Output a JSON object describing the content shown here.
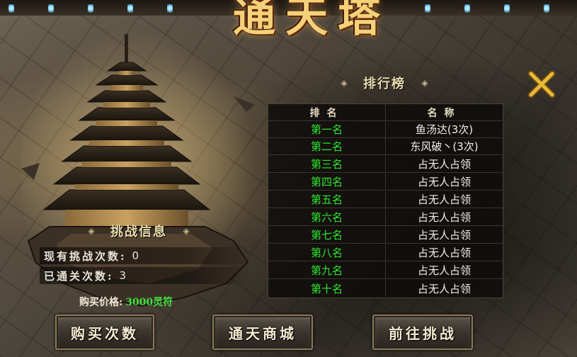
{
  "title": "通天塔",
  "ranking": {
    "header": "排行榜",
    "columns": [
      "排名",
      "名称"
    ],
    "rows": [
      {
        "rank": "第一名",
        "name": "鱼汤达(3次)"
      },
      {
        "rank": "第二名",
        "name": "东风破丶(3次)"
      },
      {
        "rank": "第三名",
        "name": "占无人占领"
      },
      {
        "rank": "第四名",
        "name": "占无人占领"
      },
      {
        "rank": "第五名",
        "name": "占无人占领"
      },
      {
        "rank": "第六名",
        "name": "占无人占领"
      },
      {
        "rank": "第七名",
        "name": "占无人占领"
      },
      {
        "rank": "第八名",
        "name": "占无人占领"
      },
      {
        "rank": "第九名",
        "name": "占无人占领"
      },
      {
        "rank": "第十名",
        "name": "占无人占领"
      }
    ]
  },
  "challenge_info": {
    "header": "挑战信息",
    "current_label": "现有挑战次数:",
    "current_value": "0",
    "passed_label": "已通关次数:",
    "passed_value": "3",
    "price_label": "购买价格:",
    "price_value": "3000灵符"
  },
  "buttons": {
    "buy": "购买次数",
    "shop": "通天商城",
    "challenge": "前往挑战"
  },
  "colors": {
    "rank_green": "#2ee62e",
    "title_gold": "#f4d27a",
    "price_green": "#3fe13f"
  },
  "icons": {
    "close": "close-x-icon",
    "ornament": "diamond-ornament-icon"
  }
}
